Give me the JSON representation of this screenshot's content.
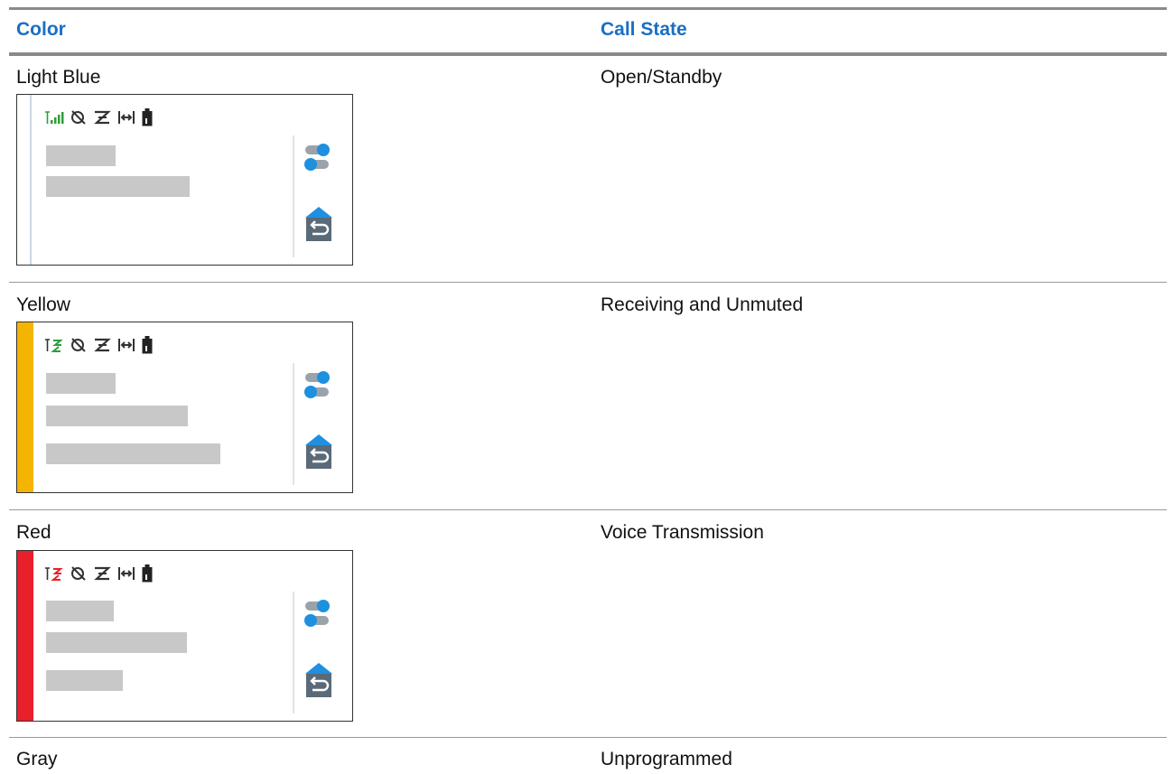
{
  "table": {
    "headers": {
      "color": "Color",
      "call_state": "Call State"
    },
    "rows": [
      {
        "color": "Light Blue",
        "state": "Open/Standby",
        "strip": "light-blue"
      },
      {
        "color": "Yellow",
        "state": "Receiving and Unmuted",
        "strip": "yellow"
      },
      {
        "color": "Red",
        "state": "Voice Transmission",
        "strip": "red"
      },
      {
        "color": "Gray",
        "state": "Unprogrammed"
      }
    ]
  },
  "colors": {
    "header_text": "#1a6fc4",
    "light_blue_strip": "#c9d6e4",
    "yellow_strip": "#f5b400",
    "red_strip": "#e8202a",
    "icon_blue": "#1e90e0",
    "icon_gray": "#5a6a78",
    "placeholder_gray": "#c8c8c8",
    "signal_green": "#2e9e3a"
  },
  "icons": [
    "signal-icon",
    "no-gps-icon",
    "scan-off-icon",
    "talkaround-icon",
    "battery-icon",
    "toggle-settings-icon",
    "home-back-icon"
  ]
}
